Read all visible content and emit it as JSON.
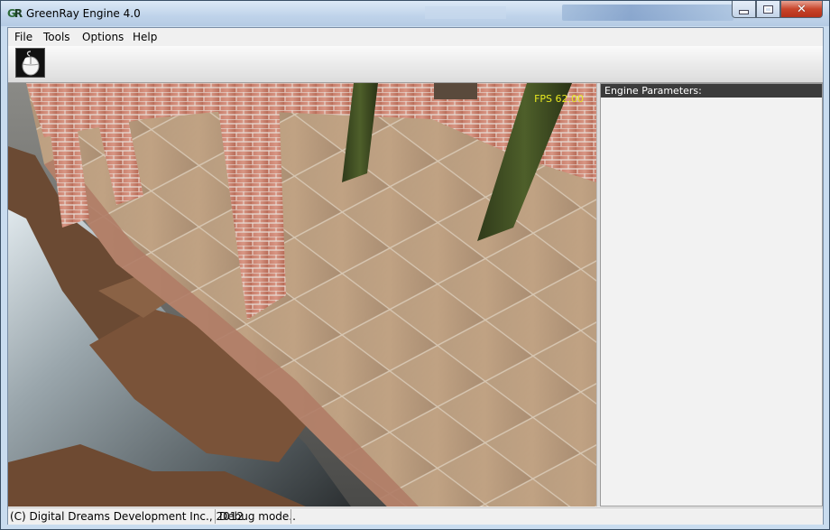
{
  "window": {
    "title": "GreenRay Engine 4.0",
    "logo_text": "GR"
  },
  "menu": {
    "items": [
      {
        "label": "File"
      },
      {
        "label": "Tools"
      },
      {
        "label": "Options"
      },
      {
        "label": "Help"
      }
    ]
  },
  "toolbar": {
    "tools": [
      {
        "icon": "mouse-icon"
      }
    ]
  },
  "viewport": {
    "fps_text": "FPS 62.00"
  },
  "panel": {
    "title": "Engine Parameters:"
  },
  "status": {
    "copyright": "(C) Digital Dreams Development Inc., 2012",
    "mode": "Debug mode.."
  },
  "colors": {
    "fps": "#e8e820",
    "panel_header": "#3c3c3c",
    "close_button": "#c8452b"
  }
}
